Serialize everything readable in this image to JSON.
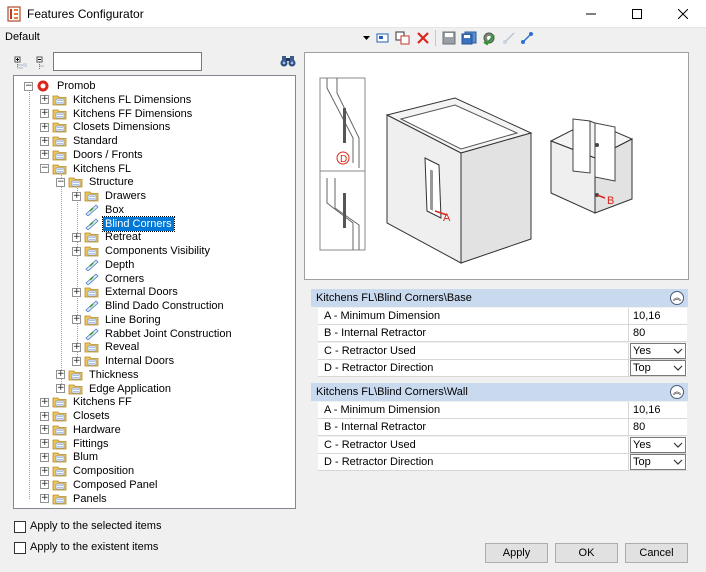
{
  "window": {
    "title": "Features Configurator"
  },
  "profile": {
    "label": "Default"
  },
  "search": {
    "value": "",
    "placeholder": ""
  },
  "tree": {
    "root": "Promob",
    "items": [
      "Kitchens FL Dimensions",
      "Kitchens FF Dimensions",
      "Closets Dimensions",
      "Standard",
      "Doors / Fronts",
      "Kitchens FL",
      "Structure",
      "Drawers",
      "Box",
      "Blind Corners",
      "Retreat",
      "Components Visibility",
      "Depth",
      "Corners",
      "External Doors",
      "Blind Dado Construction",
      "Line Boring",
      "Rabbet Joint Construction",
      "Reveal",
      "Internal Doors",
      "Thickness",
      "Edge Application",
      "Kitchens FF",
      "Closets",
      "Hardware",
      "Fittings",
      "Blum",
      "Composition",
      "Composed Panel",
      "Panels"
    ]
  },
  "preview": {
    "label_a": "A",
    "label_b": "B",
    "label_d": "D"
  },
  "groups": [
    {
      "title": "Kitchens FL\\Blind Corners\\Base",
      "rows": [
        {
          "name": "A - Minimum Dimension",
          "value": "10,16"
        },
        {
          "name": "B - Internal Retractor",
          "value": "80"
        },
        {
          "name": "C - Retractor Used",
          "value": "Yes"
        },
        {
          "name": "D - Retractor Direction",
          "value": "Top"
        }
      ]
    },
    {
      "title": "Kitchens FL\\Blind Corners\\Wall",
      "rows": [
        {
          "name": "A - Minimum Dimension",
          "value": "10,16"
        },
        {
          "name": "B - Internal Retractor",
          "value": "80"
        },
        {
          "name": "C - Retractor Used",
          "value": "Yes"
        },
        {
          "name": "D - Retractor Direction",
          "value": "Top"
        }
      ]
    }
  ],
  "options": {
    "apply_selected": "Apply to the selected items",
    "apply_existent": "Apply to the existent items"
  },
  "buttons": {
    "apply": "Apply",
    "ok": "OK",
    "cancel": "Cancel"
  },
  "colors": {
    "accent": "#0078d7",
    "group_header": "#c9d9ee",
    "folder": "#e8b84a"
  }
}
